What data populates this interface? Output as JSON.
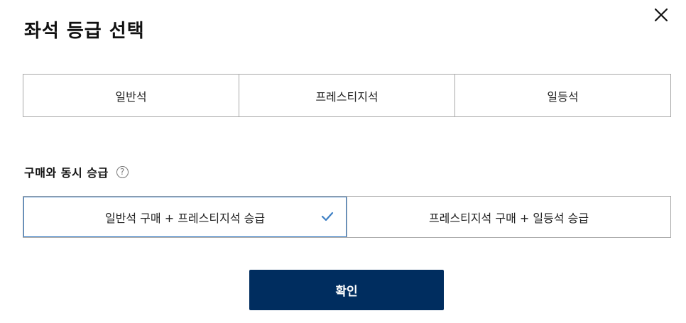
{
  "dialog": {
    "title": "좌석 등급 선택",
    "close_icon": "close-icon"
  },
  "seat_classes": [
    {
      "label": "일반석"
    },
    {
      "label": "프레스티지석"
    },
    {
      "label": "일등석"
    }
  ],
  "upgrade": {
    "heading": "구매와 동시 승급",
    "help_icon": "question-circle-icon",
    "help_glyph": "?",
    "options": [
      {
        "label": "일반석 구매 + 프레스티지석 승급",
        "selected": true
      },
      {
        "label": "프레스티지석 구매 + 일등석 승급",
        "selected": false
      }
    ],
    "check_icon": "checkmark-icon",
    "selected_color": "#3d7fc4"
  },
  "confirm_button": {
    "label": "확인",
    "background": "#002d5f"
  }
}
